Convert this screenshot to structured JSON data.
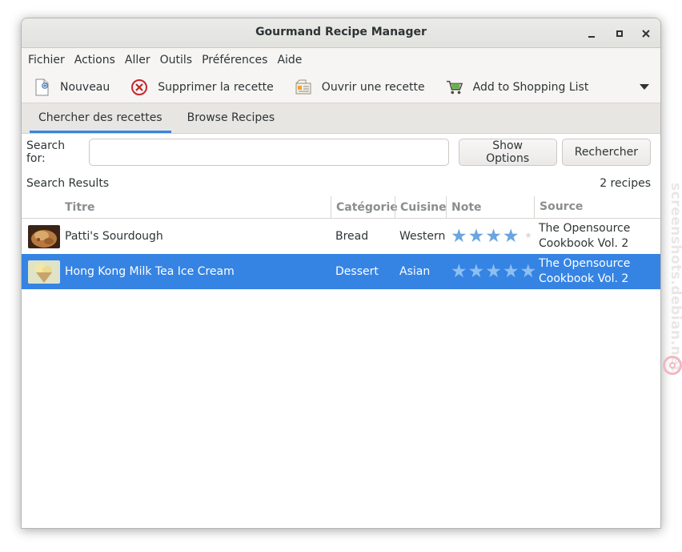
{
  "window": {
    "title": "Gourmand Recipe Manager"
  },
  "menubar": {
    "items": [
      "Fichier",
      "Actions",
      "Aller",
      "Outils",
      "Préférences",
      "Aide"
    ]
  },
  "toolbar": {
    "new_label": "Nouveau",
    "delete_label": "Supprimer la recette",
    "open_label": "Ouvrir une recette",
    "shopping_label": "Add to Shopping List"
  },
  "tabs": [
    {
      "label": "Chercher des recettes",
      "active": true
    },
    {
      "label": "Browse Recipes",
      "active": false
    }
  ],
  "search": {
    "label": "Search for:",
    "value": "",
    "show_options_label": "Show Options",
    "search_button_label": "Rechercher"
  },
  "results": {
    "heading": "Search Results",
    "count": "2 recipes",
    "columns": [
      "Titre",
      "Catégorie",
      "Cuisine",
      "Note",
      "Source"
    ],
    "rows": [
      {
        "title": "Patti's Sourdough",
        "category": "Bread",
        "cuisine": "Western",
        "rating": 4,
        "rating_max": 5,
        "source_line1": "The Opensource",
        "source_line2": "Cookbook Vol. 2",
        "selected": false
      },
      {
        "title": "Hong Kong Milk Tea Ice Cream",
        "category": "Dessert",
        "cuisine": "Asian",
        "rating": 5,
        "rating_max": 5,
        "source_line1": "The Opensource",
        "source_line2": "Cookbook Vol. 2",
        "selected": true
      }
    ]
  },
  "watermark": {
    "text": "screenshots.debian.net"
  },
  "colors": {
    "accent": "#3584e4",
    "star": "#6aa5e0",
    "watermark": "#f0b8c4"
  }
}
